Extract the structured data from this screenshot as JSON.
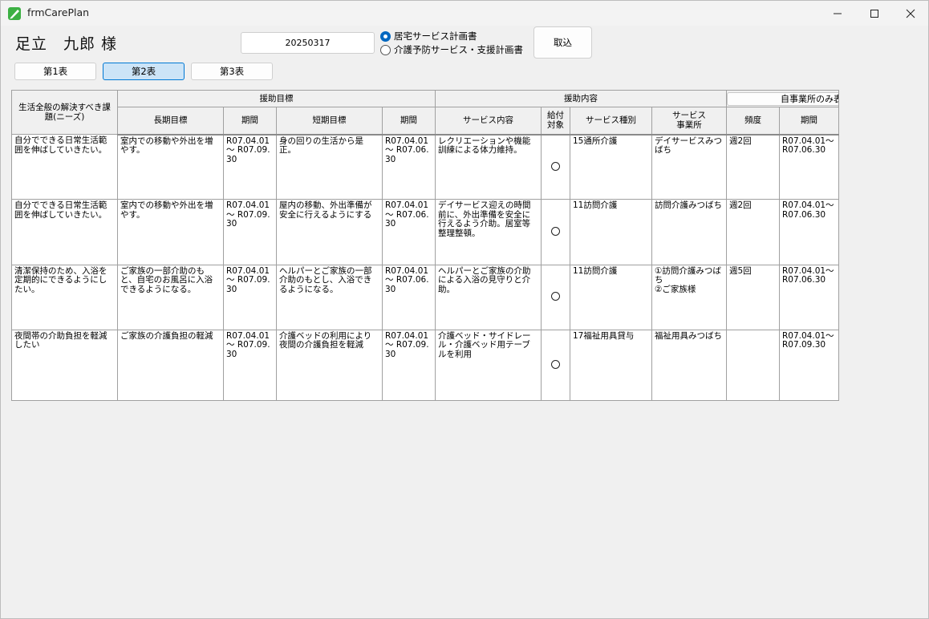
{
  "window": {
    "title": "frmCarePlan"
  },
  "header": {
    "customer_name": "足立　九郎 様",
    "date_value": "20250317",
    "radio_options": [
      {
        "label": "居宅サービス計画書",
        "selected": true
      },
      {
        "label": "介護予防サービス・支援計画書",
        "selected": false
      }
    ],
    "import_label": "取込"
  },
  "tabs": [
    {
      "label": "第1表",
      "active": false
    },
    {
      "label": "第2表",
      "active": true
    },
    {
      "label": "第3表",
      "active": false
    }
  ],
  "table": {
    "group_headers": {
      "needs": "生活全般の解決すべき課題(ニーズ)",
      "goals": "援助目標",
      "content": "援助内容",
      "own_only_button": "自事業所のみ表示"
    },
    "columns": {
      "long_goal": "長期目標",
      "long_period": "期間",
      "short_goal": "短期目標",
      "short_period": "期間",
      "service_content": "サービス内容",
      "benefit": "給付対象",
      "service_type": "サービス種別",
      "provider": "サービス事業所",
      "frequency": "頻度",
      "period": "期間"
    },
    "rows": [
      {
        "needs": "自分でできる日常生活範囲を伸ばしていきたい。",
        "long_goal": "室内での移動や外出を増やす。",
        "long_period": "R07.04.01 ～ R07.09.30",
        "short_goal": "身の回りの生活から是正。",
        "short_period": "R07.04.01 ～ R07.06.30",
        "service_content": "レクリエーションや機能訓練による体力維持。",
        "benefit": "○",
        "service_type": "15通所介護",
        "provider": "デイサービスみつばち",
        "frequency": "週2回",
        "period": "R07.04.01～ R07.06.30"
      },
      {
        "needs": "自分でできる日常生活範囲を伸ばしていきたい。",
        "long_goal": "室内での移動や外出を増やす。",
        "long_period": "R07.04.01 ～ R07.09.30",
        "short_goal": "屋内の移動、外出準備が安全に行えるようにする",
        "short_period": "R07.04.01 ～ R07.06.30",
        "service_content": "デイサービス迎えの時間前に、外出準備を安全に行えるよう介助。居室等整理整頓。",
        "benefit": "○",
        "service_type": "11訪問介護",
        "provider": "訪問介護みつばち",
        "frequency": "週2回",
        "period": "R07.04.01～ R07.06.30"
      },
      {
        "needs": "清潔保持のため、入浴を定期的にできるようにしたい。",
        "long_goal": "ご家族の一部介助のもと、自宅のお風呂に入浴できるようになる。",
        "long_period": "R07.04.01 ～ R07.09.30",
        "short_goal": "ヘルパーとご家族の一部介助のもとし、入浴できるようになる。",
        "short_period": "R07.04.01 ～ R07.06.30",
        "service_content": "ヘルパーとご家族の介助による入浴の見守りと介助。",
        "benefit": "○",
        "service_type": "11訪問介護",
        "provider": "①訪問介護みつばち\n②ご家族様",
        "frequency": "週5回",
        "period": "R07.04.01～ R07.06.30"
      },
      {
        "needs": "夜間帯の介助負担を軽減したい",
        "long_goal": "ご家族の介護負担の軽減",
        "long_period": "R07.04.01 ～ R07.09.30",
        "short_goal": "介護ベッドの利用により夜間の介護負担を軽減",
        "short_period": "R07.04.01 ～ R07.09.30",
        "service_content": "介護ベッド・サイドレール・介護ベッド用テーブルを利用",
        "benefit": "○",
        "service_type": "17福祉用具貸与",
        "provider": "福祉用具みつばち",
        "frequency": "",
        "period": "R07.04.01～ R07.09.30"
      }
    ]
  }
}
